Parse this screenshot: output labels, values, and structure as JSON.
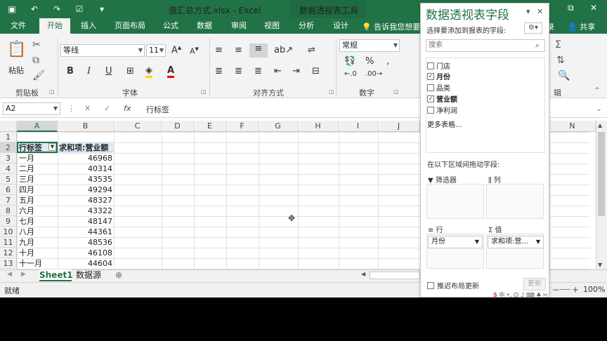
{
  "title_bar": {
    "title": "值汇总方式.xlsx - Excel",
    "contextual_tools": "数据透视表工具",
    "qat_icons": [
      "save-icon",
      "undo-icon",
      "redo-icon",
      "form-icon",
      "customize-icon"
    ]
  },
  "tabs": [
    "文件",
    "开始",
    "插入",
    "页面布局",
    "公式",
    "数据",
    "审阅",
    "视图",
    "分析",
    "设计"
  ],
  "active_tab": "开始",
  "tell_me": "告诉我您想要做",
  "login_label": "录",
  "share_label": "共享",
  "ribbon": {
    "paste_label": "粘贴",
    "clipboard_label": "剪贴板",
    "font_name": "等线",
    "font_size": "11",
    "font_group_label": "字体",
    "align_group_label": "对齐方式",
    "number_format": "常规",
    "number_group_label": "数字",
    "edit_group_label": "辑"
  },
  "formula_bar": {
    "name_box": "A2",
    "formula": "行标签"
  },
  "grid": {
    "columns": [
      "A",
      "B",
      "C",
      "D",
      "E",
      "F",
      "G",
      "H",
      "I",
      "J",
      "N"
    ],
    "rows": [
      "1",
      "2",
      "3",
      "4",
      "5",
      "6",
      "7",
      "8",
      "9",
      "10",
      "11",
      "12",
      "13"
    ],
    "header_row": {
      "a": "行标签",
      "b": "求和项:营业额"
    },
    "data": [
      {
        "month": "一月",
        "value": "46968"
      },
      {
        "month": "二月",
        "value": "40314"
      },
      {
        "month": "三月",
        "value": "43535"
      },
      {
        "month": "四月",
        "value": "49294"
      },
      {
        "month": "五月",
        "value": "48327"
      },
      {
        "month": "六月",
        "value": "43322"
      },
      {
        "month": "七月",
        "value": "48147"
      },
      {
        "month": "八月",
        "value": "44361"
      },
      {
        "month": "九月",
        "value": "48536"
      },
      {
        "month": "十月",
        "value": "46108"
      },
      {
        "month": "十一月",
        "value": "44604"
      }
    ]
  },
  "sheets": [
    "Sheet1",
    "数据源"
  ],
  "status": "就绪",
  "zoom": "100%",
  "pivot_panel": {
    "title": "数据透视表字段",
    "subtitle": "选择要添加到报表的字段:",
    "search_placeholder": "搜索",
    "fields": [
      {
        "name": "门店",
        "checked": false
      },
      {
        "name": "月份",
        "checked": true
      },
      {
        "name": "品类",
        "checked": false
      },
      {
        "name": "营业额",
        "checked": true
      },
      {
        "name": "净利润",
        "checked": false
      }
    ],
    "more_tables": "更多表格...",
    "drag_hint": "在以下区域间拖动字段:",
    "areas": {
      "filters": "筛选器",
      "columns": "列",
      "rows": "行",
      "values": "值"
    },
    "rows_field": "月份",
    "values_field": "求和项:营...",
    "defer_label": "推迟布局更新",
    "update_label": "更新"
  },
  "colors": {
    "excel_green": "#217346",
    "pivot_header_fill": "#ddebf7"
  }
}
